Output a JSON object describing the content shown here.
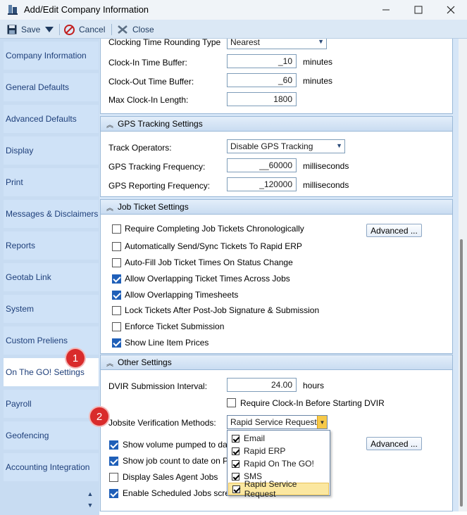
{
  "window": {
    "title": "Add/Edit Company Information"
  },
  "toolbar": {
    "save": "Save",
    "cancel": "Cancel",
    "close": "Close"
  },
  "sidebar": {
    "items": [
      {
        "label": "Company Information"
      },
      {
        "label": "General Defaults"
      },
      {
        "label": "Advanced Defaults"
      },
      {
        "label": "Display"
      },
      {
        "label": "Print"
      },
      {
        "label": "Messages & Disclaimers"
      },
      {
        "label": "Reports"
      },
      {
        "label": "Geotab Link"
      },
      {
        "label": "System"
      },
      {
        "label": "Custom Preliens"
      },
      {
        "label": "On The GO! Settings",
        "active": true
      },
      {
        "label": "Payroll"
      },
      {
        "label": "Geofencing"
      },
      {
        "label": "Accounting Integration"
      }
    ]
  },
  "clocking": {
    "rounding_label": "Clocking Time Rounding Type",
    "rounding_value": "Nearest",
    "clock_in_label": "Clock-In Time Buffer:",
    "clock_in_value": "_10",
    "clock_out_label": "Clock-Out Time Buffer:",
    "clock_out_value": "_60",
    "minutes": "minutes",
    "max_label": "Max Clock-In Length:",
    "max_value": "1800"
  },
  "gps": {
    "header": "GPS Tracking Settings",
    "track_label": "Track Operators:",
    "track_value": "Disable GPS Tracking",
    "freq_label": "GPS Tracking Frequency:",
    "freq_value": "__60000",
    "report_label": "GPS Reporting Frequency:",
    "report_value": "_120000",
    "ms": "milliseconds"
  },
  "job_ticket": {
    "header": "Job Ticket Settings",
    "advanced": "Advanced ...",
    "options": [
      {
        "label": "Require Completing Job Tickets Chronologically",
        "checked": false
      },
      {
        "label": "Automatically Send/Sync Tickets To Rapid ERP",
        "checked": false
      },
      {
        "label": "Auto-Fill Job Ticket Times On Status Change",
        "checked": false
      },
      {
        "label": "Allow Overlapping Ticket Times Across Jobs",
        "checked": true
      },
      {
        "label": "Allow Overlapping Timesheets",
        "checked": true
      },
      {
        "label": "Lock Tickets After Post-Job Signature & Submission",
        "checked": false
      },
      {
        "label": "Enforce Ticket Submission",
        "checked": false
      },
      {
        "label": "Show Line Item Prices",
        "checked": true
      }
    ]
  },
  "other": {
    "header": "Other Settings",
    "dvir_label": "DVIR Submission Interval:",
    "dvir_value": "24.00",
    "hours": "hours",
    "require_clock_in": "Require Clock-In Before Starting DVIR",
    "jobsite_label": "Jobsite Verification Methods:",
    "jobsite_value": "Rapid Service Request",
    "advanced": "Advanced ...",
    "options": [
      {
        "label": "Show volume pumped to date o",
        "checked": true
      },
      {
        "label": "Show job count to date on Profi",
        "checked": true
      },
      {
        "label": "Display Sales Agent Jobs",
        "checked": false
      },
      {
        "label": "Enable Scheduled Jobs screen",
        "checked": true
      }
    ],
    "methods": [
      {
        "label": "Email",
        "checked": true
      },
      {
        "label": "Rapid ERP",
        "checked": true
      },
      {
        "label": "Rapid On The GO!",
        "checked": true
      },
      {
        "label": "SMS",
        "checked": true
      },
      {
        "label": "Rapid Service Request",
        "checked": true,
        "highlighted": true
      }
    ]
  },
  "badges": [
    "1",
    "2"
  ]
}
